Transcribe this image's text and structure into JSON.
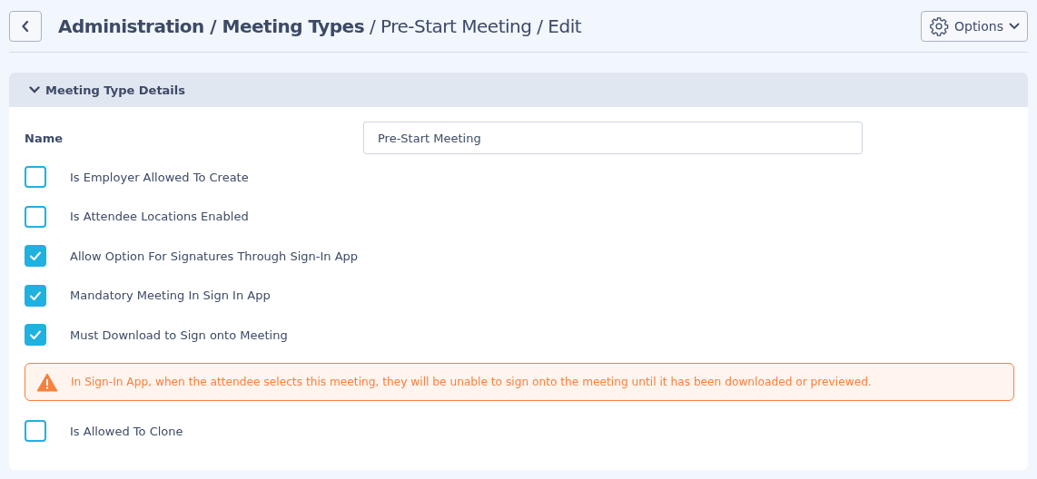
{
  "header": {
    "title": "**Administration / Meeting Types** / Pre-Start Meeting / Edit",
    "options_label": "Options"
  },
  "section": {
    "title": "Meeting Type Details",
    "expanded": true,
    "name_field": {
      "label": "Name",
      "value": "Pre-Start Meeting"
    },
    "items": [
      {
        "kind": "checkbox",
        "label": "Is Employer Allowed To Create",
        "checked": false
      },
      {
        "kind": "checkbox",
        "label": "Is Attendee Locations Enabled",
        "checked": false
      },
      {
        "kind": "checkbox",
        "label": "Allow Option For Signatures Through Sign-In App",
        "checked": true
      },
      {
        "kind": "checkbox",
        "label": "Mandatory Meeting In Sign In App",
        "checked": true
      },
      {
        "kind": "checkbox",
        "label": "Must Download to Sign onto Meeting",
        "checked": true
      },
      {
        "kind": "warning",
        "label": "In Sign-In App, when the attendee selects this meeting, they will be unable to sign onto the meeting until it has been downloaded or previewed."
      },
      {
        "kind": "checkbox",
        "label": "Is Allowed To Clone",
        "checked": false
      }
    ]
  }
}
